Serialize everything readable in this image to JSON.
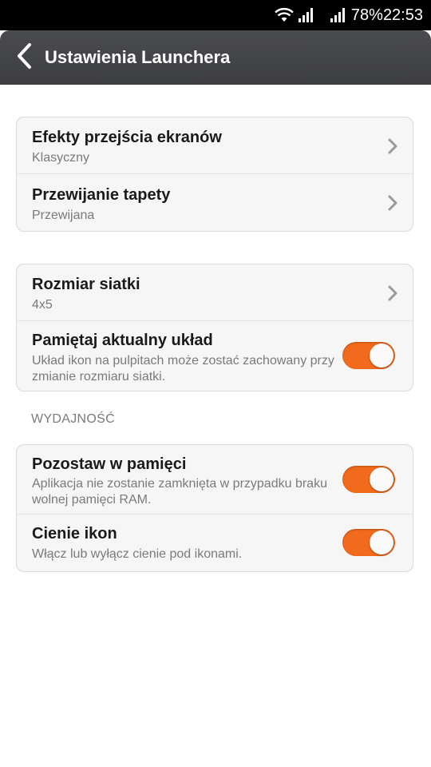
{
  "status_bar": {
    "battery": "78%",
    "time": "22:53",
    "icons": [
      "wifi-icon",
      "signal-icon",
      "signal-icon"
    ]
  },
  "header": {
    "title": "Ustawienia Launchera",
    "back_icon": "chevron-left-icon"
  },
  "groups": [
    {
      "items": [
        {
          "title": "Efekty przejścia ekranów",
          "subtitle": "Klasyczny",
          "control": "chevron"
        },
        {
          "title": "Przewijanie tapety",
          "subtitle": "Przewijana",
          "control": "chevron"
        }
      ]
    },
    {
      "items": [
        {
          "title": "Rozmiar siatki",
          "subtitle": "4x5",
          "control": "chevron"
        },
        {
          "title": "Pamiętaj aktualny układ",
          "subtitle": "Układ ikon na pulpitach może zostać zachowany przy zmianie rozmiaru siatki.",
          "control": "toggle",
          "on": true
        }
      ]
    },
    {
      "header": "WYDAJNOŚĆ",
      "items": [
        {
          "title": "Pozostaw w pamięci",
          "subtitle": "Aplikacja nie zostanie zamknięta w przypadku braku wolnej pamięci RAM.",
          "control": "toggle",
          "on": true
        },
        {
          "title": "Cienie ikon",
          "subtitle": "Włącz lub wyłącz cienie pod ikonami.",
          "control": "toggle",
          "on": true
        }
      ]
    }
  ],
  "colors": {
    "accent": "#f26a1b",
    "title_bar": "#434448",
    "card_background": "#f6f6f6",
    "secondary_text": "#7a7a7a"
  }
}
